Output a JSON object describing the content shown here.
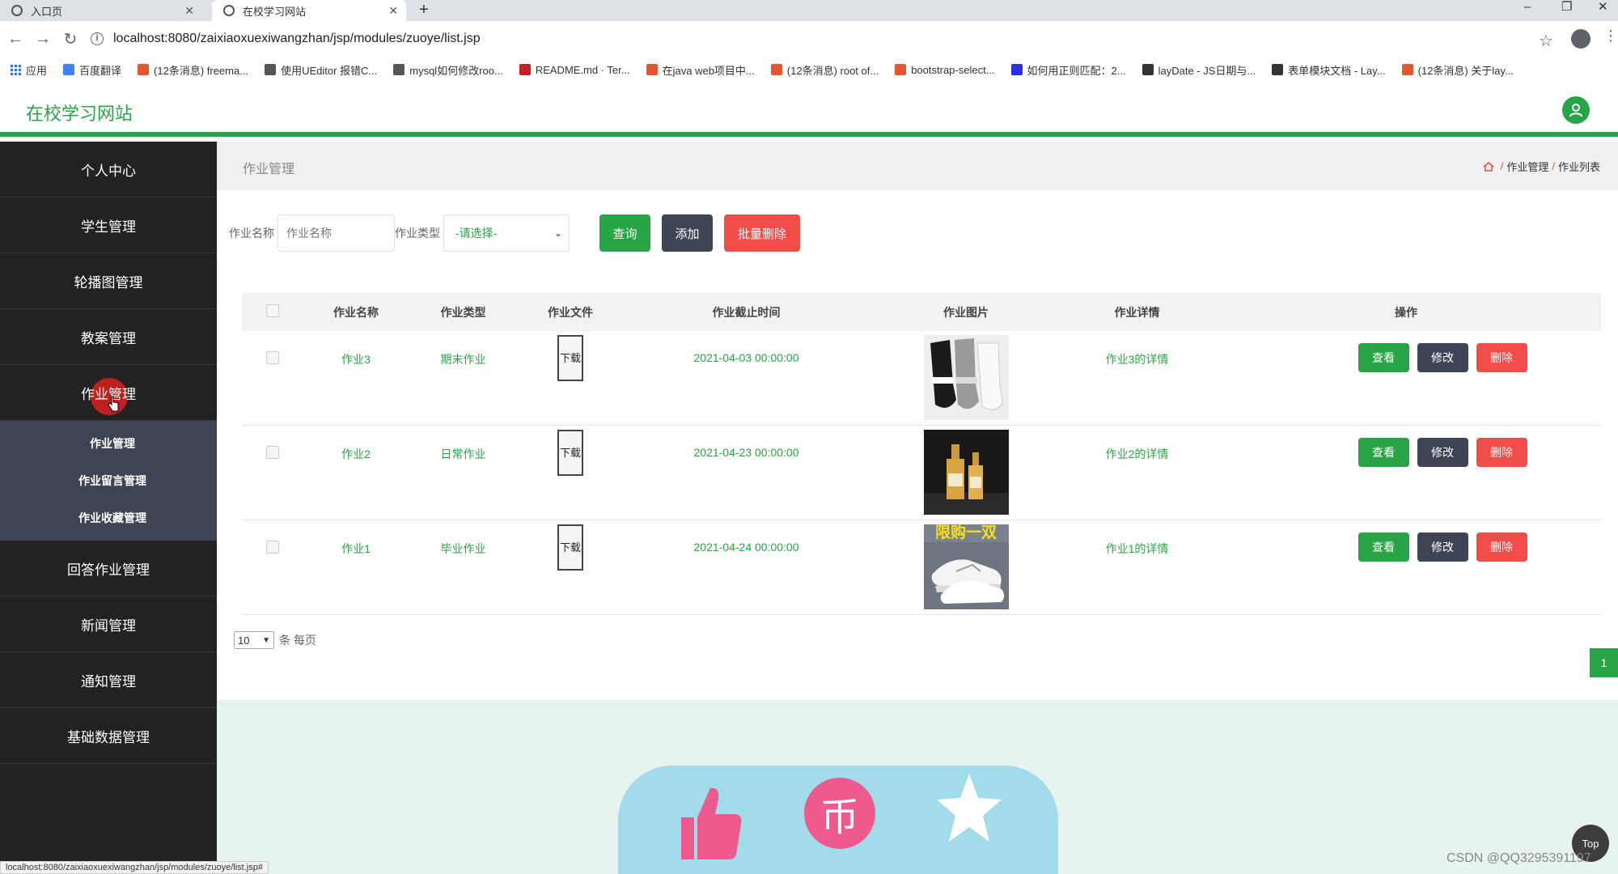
{
  "browser": {
    "tabs": [
      {
        "title": "入口页",
        "active": false
      },
      {
        "title": "在校学习网站",
        "active": true
      }
    ],
    "url": "localhost:8080/zaixiaoxuexiwangzhan/jsp/modules/zuoye/list.jsp",
    "status_url": "localhost:8080/zaixiaoxuexiwangzhan/jsp/modules/zuoye/list.jsp#",
    "bookmarks": [
      {
        "label": "应用",
        "color": "#1a73e8"
      },
      {
        "label": "百度翻译",
        "color": "#3b82f6"
      },
      {
        "label": "(12条消息) freema...",
        "color": "#e4572e"
      },
      {
        "label": "使用UEditor 报错C...",
        "color": "#555555"
      },
      {
        "label": "mysql如何修改roo...",
        "color": "#555555"
      },
      {
        "label": "README.md · Ter...",
        "color": "#c71d23"
      },
      {
        "label": "在java web项目中...",
        "color": "#e4572e"
      },
      {
        "label": "(12条消息) root of...",
        "color": "#e4572e"
      },
      {
        "label": "bootstrap-select...",
        "color": "#e4572e"
      },
      {
        "label": "如何用正则匹配：2...",
        "color": "#2932e1"
      },
      {
        "label": "layDate - JS日期与...",
        "color": "#333333"
      },
      {
        "label": "表单模块文档 - Lay...",
        "color": "#333333"
      },
      {
        "label": "(12条消息) 关于lay...",
        "color": "#e4572e"
      }
    ]
  },
  "header": {
    "site_title": "在校学习网站",
    "accent": "#27a445"
  },
  "sidebar": {
    "items": [
      {
        "label": "个人中心"
      },
      {
        "label": "学生管理"
      },
      {
        "label": "轮播图管理"
      },
      {
        "label": "教案管理"
      },
      {
        "label": "作业管理",
        "active": true
      }
    ],
    "submenu": [
      {
        "label": "作业管理"
      },
      {
        "label": "作业留言管理"
      },
      {
        "label": "作业收藏管理"
      }
    ],
    "items_after": [
      {
        "label": "回答作业管理"
      },
      {
        "label": "新闻管理"
      },
      {
        "label": "通知管理"
      },
      {
        "label": "基础数据管理"
      }
    ]
  },
  "page": {
    "title": "作业管理",
    "breadcrumb": [
      "作业管理",
      "作业列表"
    ]
  },
  "search": {
    "name_label": "作业名称",
    "name_placeholder": "作业名称",
    "type_label": "作业类型",
    "type_selected": "-请选择-",
    "query_button": "查询",
    "add_button": "添加",
    "batch_delete_button": "批量删除"
  },
  "table": {
    "headers": [
      "作业名称",
      "作业类型",
      "作业文件",
      "作业截止时间",
      "作业图片",
      "作业详情",
      "操作"
    ],
    "rows": [
      {
        "name": "作业3",
        "type": "期末作业",
        "file": "下载",
        "deadline": "2021-04-03 00:00:00",
        "image": "socks",
        "detail": "作业3的详情"
      },
      {
        "name": "作业2",
        "type": "日常作业",
        "file": "下载",
        "deadline": "2021-04-23 00:00:00",
        "image": "bottles",
        "detail": "作业2的详情"
      },
      {
        "name": "作业1",
        "type": "毕业作业",
        "file": "下载",
        "deadline": "2021-04-24 00:00:00",
        "image": "sneakers",
        "detail": "作业1的详情",
        "image_text": "限购一双"
      }
    ],
    "ops": {
      "view": "查看",
      "edit": "修改",
      "delete": "删除"
    }
  },
  "pager": {
    "page_size": "10",
    "suffix": "条 每页",
    "current_page": "1"
  },
  "footer": {
    "top_button": "Top",
    "watermark": "CSDN @QQ3295391197",
    "coin_glyph": "币"
  }
}
